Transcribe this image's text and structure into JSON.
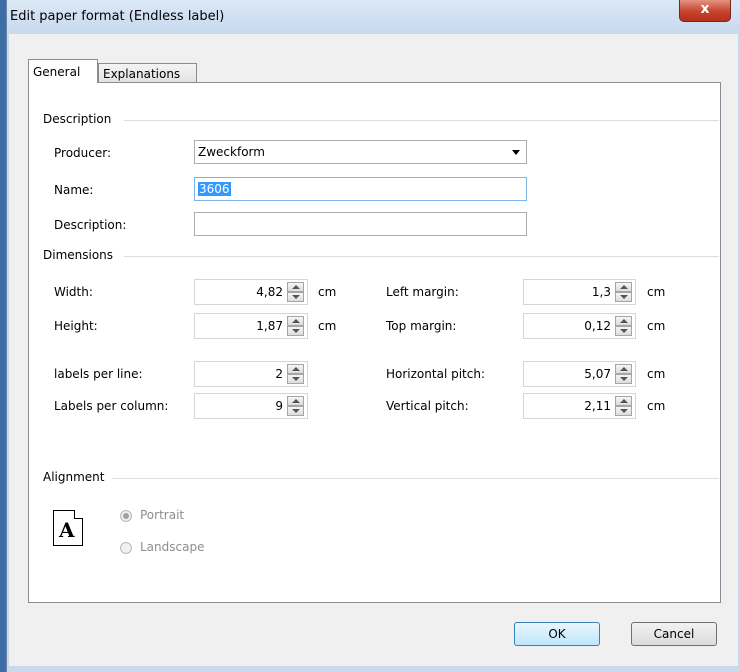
{
  "window": {
    "title": "Edit paper format (Endless label)",
    "close_glyph": "x"
  },
  "tabs": [
    {
      "label": "General"
    },
    {
      "label": "Explanations"
    }
  ],
  "description": {
    "section_label": "Description",
    "producer": {
      "label": "Producer:",
      "value": "Zweckform"
    },
    "name": {
      "label": "Name:",
      "value": "3606"
    },
    "description": {
      "label": "Description:",
      "value": ""
    }
  },
  "dimensions": {
    "section_label": "Dimensions",
    "width": {
      "label": "Width:",
      "value": "4,82",
      "unit": "cm"
    },
    "height": {
      "label": "Height:",
      "value": "1,87",
      "unit": "cm"
    },
    "labels_per_line": {
      "label": "labels per line:",
      "value": "2"
    },
    "labels_per_column": {
      "label": "Labels per column:",
      "value": "9"
    },
    "left_margin": {
      "label": "Left margin:",
      "value": "1,3",
      "unit": "cm"
    },
    "top_margin": {
      "label": "Top margin:",
      "value": "0,12",
      "unit": "cm"
    },
    "horizontal_pitch": {
      "label": "Horizontal pitch:",
      "value": "5,07",
      "unit": "cm"
    },
    "vertical_pitch": {
      "label": "Vertical pitch:",
      "value": "2,11",
      "unit": "cm"
    }
  },
  "alignment": {
    "section_label": "Alignment",
    "icon_glyph": "A",
    "portrait": {
      "label": "Portrait",
      "checked": true
    },
    "landscape": {
      "label": "Landscape",
      "checked": false
    }
  },
  "buttons": {
    "ok": "OK",
    "cancel": "Cancel"
  }
}
